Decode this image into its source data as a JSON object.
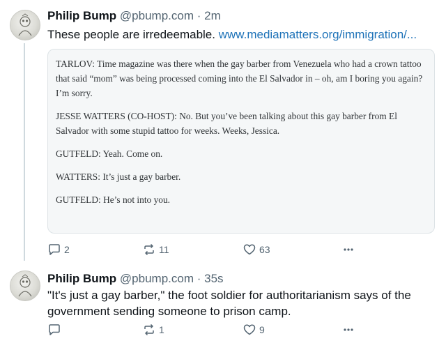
{
  "posts": [
    {
      "author_name": "Philip Bump",
      "handle": "@pbump.com",
      "separator": "·",
      "time": "2m",
      "text": "These people are irredeemable.",
      "link": "www.mediamatters.org/immigration/...",
      "quote": [
        "TARLOV: Time magazine was there when the gay barber from Venezuela who had a crown tattoo that said “mom” was being processed coming into the El Salvador in – oh, am I boring you again? I’m sorry.",
        "JESSE WATTERS (CO-HOST): No. But you’ve been talking about this gay barber from El Salvador with some stupid tattoo for weeks. Weeks, Jessica.",
        "GUTFELD: Yeah. Come on.",
        "WATTERS: It’s just a gay barber.",
        "GUTFELD: He’s not into you."
      ],
      "replies": "2",
      "reposts": "11",
      "likes": "63"
    },
    {
      "author_name": "Philip Bump",
      "handle": "@pbump.com",
      "separator": "·",
      "time": "35s",
      "text": "\"It's just a gay barber,\" the foot soldier for authoritarianism says of the government sending someone to prison camp.",
      "replies": "",
      "reposts": "1",
      "likes": "9"
    }
  ],
  "icons": {
    "reply": "speech-bubble-icon",
    "repost": "repost-arrows-icon",
    "like": "heart-icon",
    "more": "ellipsis-icon"
  },
  "colors": {
    "text": "#0f1419",
    "muted": "#536471",
    "link": "#1d72b8",
    "quote_bg": "#f5f7f8"
  }
}
